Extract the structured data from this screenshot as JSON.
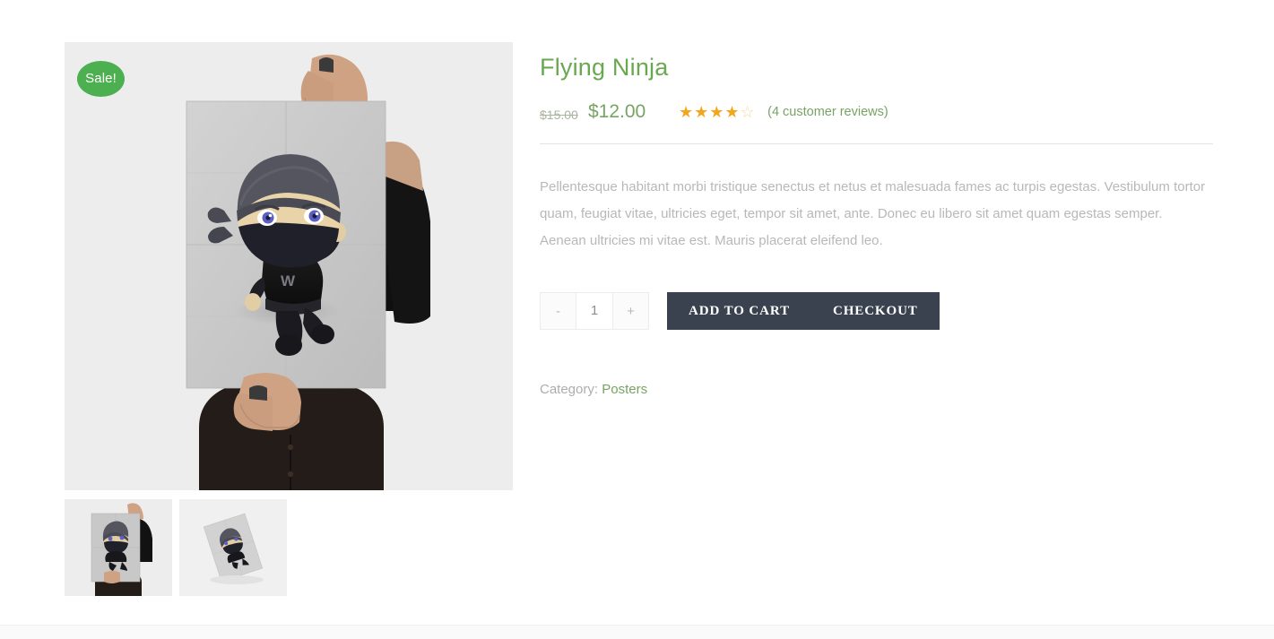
{
  "product": {
    "title": "Flying Ninja",
    "sale_badge": "Sale!",
    "price_old": "$15.00",
    "price_new": "$12.00",
    "rating_value": 4,
    "rating_max": 5,
    "stars_filled": "★★★★",
    "star_empty": "☆",
    "reviews_link": "(4 customer reviews)",
    "description": "Pellentesque habitant morbi tristique senectus et netus et malesuada fames ac turpis egestas. Vestibulum tortor quam, feugiat vitae, ultricies eget, tempor sit amet, ante. Donec eu libero sit amet quam egestas semper. Aenean ultricies mi vitae est. Mauris placerat eleifend leo."
  },
  "cart": {
    "qty_decrease": "-",
    "qty_increase": "+",
    "quantity": "1",
    "add_to_cart_label": "ADD TO CART",
    "checkout_label": "CHECKOUT"
  },
  "meta": {
    "category_label": "Category:",
    "category_value": "Posters"
  },
  "gallery": {
    "main_image_alt": "Flying Ninja poster held by a person",
    "thumbnails": [
      {
        "alt": "Poster held in hands front view"
      },
      {
        "alt": "Poster lying flat angled view"
      }
    ]
  },
  "colors": {
    "brand_green": "#77a464",
    "title_green": "#6aa84f",
    "sale_green": "#4caf50",
    "star_orange": "#f2a61e",
    "button_dark": "#3a4250",
    "image_bg": "#ededed"
  }
}
